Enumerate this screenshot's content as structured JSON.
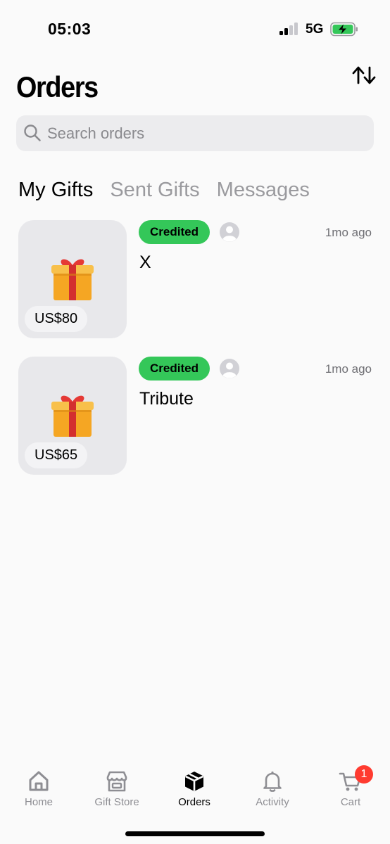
{
  "status_bar": {
    "time": "05:03",
    "network": "5G",
    "battery_color": "#34c759"
  },
  "header": {
    "title": "Orders",
    "sort_icon": "sort-arrows-icon"
  },
  "search": {
    "placeholder": "Search orders",
    "value": ""
  },
  "tabs": [
    {
      "label": "My Gifts",
      "active": true
    },
    {
      "label": "Sent Gifts",
      "active": false
    },
    {
      "label": "Messages",
      "active": false
    }
  ],
  "orders": [
    {
      "price": "US$80",
      "status": "Credited",
      "time": "1mo ago",
      "title": "X",
      "icon": "gift-icon"
    },
    {
      "price": "US$65",
      "status": "Credited",
      "time": "1mo ago",
      "title": "Tribute",
      "icon": "gift-icon"
    }
  ],
  "nav": [
    {
      "label": "Home",
      "icon": "home-icon"
    },
    {
      "label": "Gift Store",
      "icon": "store-icon"
    },
    {
      "label": "Orders",
      "icon": "box-icon",
      "active": true
    },
    {
      "label": "Activity",
      "icon": "bell-icon"
    },
    {
      "label": "Cart",
      "icon": "cart-icon",
      "badge": "1"
    }
  ],
  "colors": {
    "accent": "#34c759",
    "badge": "#ff3b30"
  }
}
